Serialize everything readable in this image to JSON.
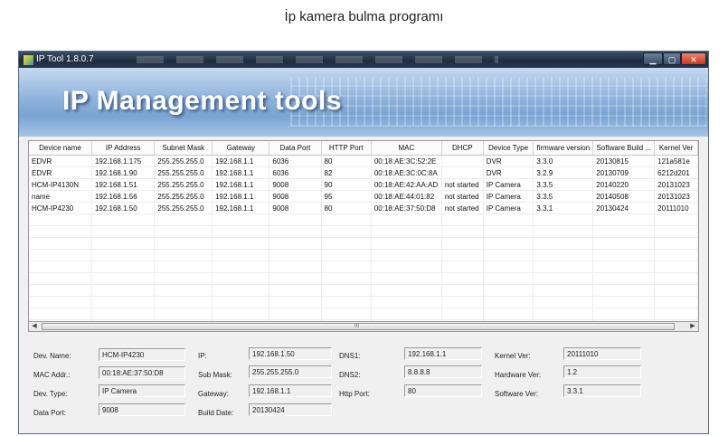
{
  "page_caption": "İp kamera bulma programı",
  "window": {
    "title": "IP Tool 1.8.0.7",
    "banner_title": "IP Management tools"
  },
  "table": {
    "columns": [
      "Device name",
      "IP Address",
      "Subnet Mask",
      "Gateway",
      "Data Port",
      "HTTP Port",
      "MAC",
      "DHCP",
      "Device Type",
      "firmware version",
      "Software Build ...",
      "Kernel Ver"
    ],
    "rows": [
      [
        "EDVR",
        "192.168.1.175",
        "255.255.255.0",
        "192.168.1.1",
        "6036",
        "80",
        "00:18:AE:3C:52:2E",
        "",
        "DVR",
        "3.3.0",
        "20130815",
        "121a581e"
      ],
      [
        "EDVR",
        "192.168.1.90",
        "255.255.255.0",
        "192.168.1.1",
        "6036",
        "82",
        "00:18:AE:3C:0C:8A",
        "",
        "DVR",
        "3.2.9",
        "20130709",
        "6212d201"
      ],
      [
        "HCM-IP4130N",
        "192.168.1.51",
        "255.255.255.0",
        "192.168.1.1",
        "9008",
        "90",
        "00:18:AE:42:AA:AD",
        "not started",
        "IP Camera",
        "3.3.5",
        "20140220",
        "20131023"
      ],
      [
        "name",
        "192.168.1.56",
        "255.255.255.0",
        "192.168.1.1",
        "9008",
        "95",
        "00:18:AE:44:01:82",
        "not started",
        "IP Camera",
        "3.3.5",
        "20140508",
        "20131023"
      ],
      [
        "HCM-IP4230",
        "192.168.1.50",
        "255.255.255.0",
        "192.168.1.1",
        "9008",
        "80",
        "00:18:AE:37:50:D8",
        "not started",
        "IP Camera",
        "3.3.1",
        "20130424",
        "20111010"
      ]
    ],
    "scroll_grip": "III",
    "scroll_left": "◀",
    "scroll_right": "▶"
  },
  "details": {
    "dev_name_label": "Dev. Name:",
    "dev_name": "HCM-IP4230",
    "mac_label": "MAC Addr.:",
    "mac": "00:18:AE:37:50:D8",
    "dev_type_label": "Dev. Type:",
    "dev_type": "IP Camera",
    "data_port_label": "Data Port:",
    "data_port": "9008",
    "ip_label": "IP:",
    "ip": "192.168.1.50",
    "sub_mask_label": "Sub Mask:",
    "sub_mask": "255.255.255.0",
    "gateway_label": "Gateway:",
    "gateway": "192.168.1.1",
    "build_date_label": "Build Date:",
    "build_date": "20130424",
    "dns1_label": "DNS1:",
    "dns1": "192.168.1.1",
    "dns2_label": "DNS2:",
    "dns2": "8.8.8.8",
    "http_port_label": "Http Port:",
    "http_port": "80",
    "kernel_ver_label": "Kernel Ver:",
    "kernel_ver": "20111010",
    "hardware_ver_label": "Hardware Ver:",
    "hardware_ver": "1.2",
    "software_ver_label": "Software Ver:",
    "software_ver": "3.3.1"
  }
}
